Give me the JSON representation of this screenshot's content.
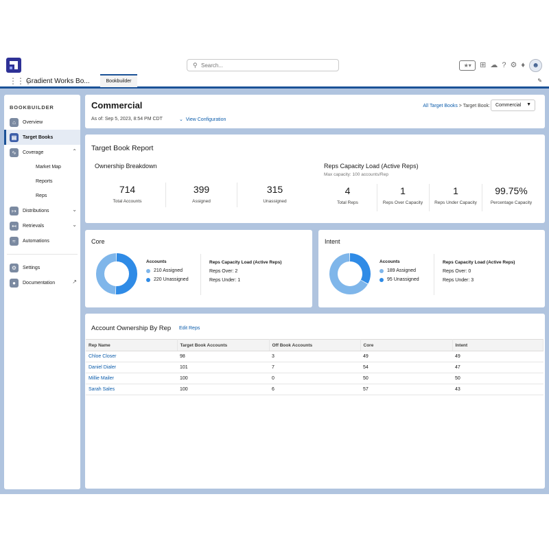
{
  "header": {
    "search_placeholder": "Search...",
    "icons": [
      "favorites-star-icon",
      "add-icon",
      "trailhead-icon",
      "help-icon",
      "setup-gear-icon",
      "notifications-bell-icon",
      "avatar"
    ]
  },
  "nav": {
    "app_name": "Gradient Works Bo...",
    "tab_label": "Bookbuilder"
  },
  "sidebar": {
    "title": "BOOKBUILDER",
    "items": [
      {
        "label": "Overview",
        "icon": "home-icon"
      },
      {
        "label": "Target Books",
        "icon": "book-icon",
        "active": true
      },
      {
        "label": "Coverage",
        "icon": "pulse-icon",
        "expanded": true
      },
      {
        "label": "Distributions",
        "icon": "share-icon"
      },
      {
        "label": "Retrievals",
        "icon": "retrieve-icon"
      },
      {
        "label": "Automations",
        "icon": "automation-icon"
      }
    ],
    "coverage_sub": [
      "Market Map",
      "Reports",
      "Reps"
    ],
    "settings_label": "Settings",
    "documentation_label": "Documentation"
  },
  "page": {
    "title": "Commercial",
    "as_of": "As of: Sep 5, 2023, 8:54 PM CDT",
    "view_config": "View Configuration",
    "breadcrumb_link": "All Target Books",
    "breadcrumb_sep": " > Target Book:",
    "selected_book": "Commercial"
  },
  "report": {
    "title": "Target Book Report",
    "ownership": {
      "title": "Ownership Breakdown",
      "stats": [
        {
          "value": "714",
          "label": "Total Accounts"
        },
        {
          "value": "399",
          "label": "Assigned"
        },
        {
          "value": "315",
          "label": "Unassigned"
        }
      ]
    },
    "capacity": {
      "title": "Reps Capacity Load (Active Reps)",
      "subtitle": "Max capacity: 100 accounts/Rep",
      "stats": [
        {
          "value": "4",
          "label": "Total Reps"
        },
        {
          "value": "1",
          "label": "Reps Over Capacity"
        },
        {
          "value": "1",
          "label": "Reps Under Capacity"
        },
        {
          "value": "99.75%",
          "label": "Percentage Capacity"
        }
      ]
    }
  },
  "segments": {
    "core": {
      "title": "Core",
      "accounts_label": "Accounts",
      "assigned": 210,
      "unassigned": 220,
      "assigned_text": "210 Assigned",
      "unassigned_text": "220 Unassigned",
      "load_title": "Reps Capacity Load (Active Reps)",
      "over": "Reps Over: 2",
      "under": "Reps Under: 1"
    },
    "intent": {
      "title": "Intent",
      "accounts_label": "Accounts",
      "assigned": 189,
      "unassigned": 95,
      "assigned_text": "189 Assigned",
      "unassigned_text": "95 Unassigned",
      "load_title": "Reps Capacity Load (Active Reps)",
      "over": "Reps Over: 0",
      "under": "Reps Under: 3"
    },
    "colors": {
      "assigned": "#7fb6ea",
      "unassigned": "#2f8be6"
    }
  },
  "table": {
    "title": "Account Ownership By Rep",
    "edit_label": "Edit Reps",
    "columns": [
      "Rep Name",
      "Target Book Accounts",
      "Off Book Accounts",
      "Core",
      "Intent"
    ],
    "rows": [
      [
        "Chloe Closer",
        "98",
        "3",
        "49",
        "49"
      ],
      [
        "Daniel Dialer",
        "101",
        "7",
        "54",
        "47"
      ],
      [
        "Millie Mailer",
        "100",
        "0",
        "50",
        "50"
      ],
      [
        "Sarah Sales",
        "100",
        "6",
        "57",
        "43"
      ]
    ]
  }
}
